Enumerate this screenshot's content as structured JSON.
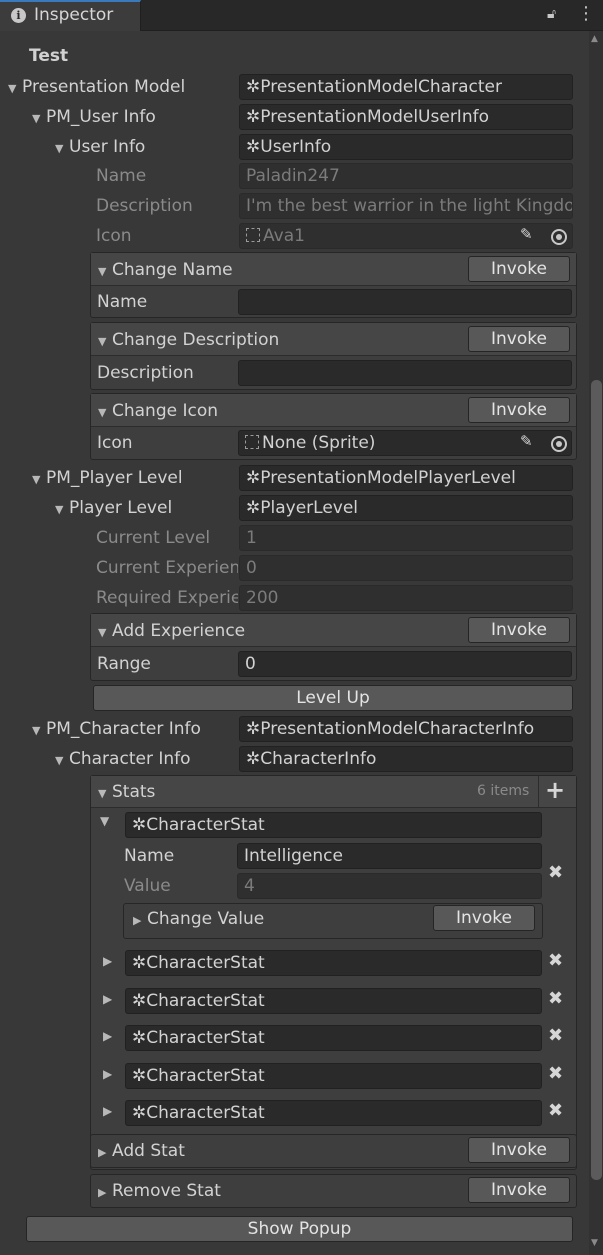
{
  "window": {
    "tab_title": "Inspector"
  },
  "header": {
    "title": "Test"
  },
  "pm": {
    "label": "Presentation Model",
    "value": "PresentationModelCharacter"
  },
  "pm_user": {
    "label": "PM_User Info",
    "value": "PresentationModelUserInfo"
  },
  "user_info": {
    "label": "User Info",
    "value": "UserInfo",
    "name_label": "Name",
    "name_value": "Paladin247",
    "desc_label": "Description",
    "desc_value": "I'm the best warrior in the light Kingdo",
    "icon_label": "Icon",
    "icon_value": "Ava1"
  },
  "change_name": {
    "label": "Change Name",
    "invoke": "Invoke",
    "param_label": "Name",
    "param_value": ""
  },
  "change_desc": {
    "label": "Change Description",
    "invoke": "Invoke",
    "param_label": "Description",
    "param_value": ""
  },
  "change_icon": {
    "label": "Change Icon",
    "invoke": "Invoke",
    "param_label": "Icon",
    "param_value": "None (Sprite)"
  },
  "pm_player": {
    "label": "PM_Player Level",
    "value": "PresentationModelPlayerLevel"
  },
  "player_level": {
    "label": "Player Level",
    "value": "PlayerLevel",
    "current_level_label": "Current Level",
    "current_level_value": "1",
    "current_exp_label": "Current Experien",
    "current_exp_value": "0",
    "required_exp_label": "Required Experie",
    "required_exp_value": "200"
  },
  "add_exp": {
    "label": "Add Experience",
    "invoke": "Invoke",
    "param_label": "Range",
    "param_value": "0"
  },
  "level_up": {
    "label": "Level Up"
  },
  "pm_char": {
    "label": "PM_Character Info",
    "value": "PresentationModelCharacterInfo"
  },
  "char_info": {
    "label": "Character Info",
    "value": "CharacterInfo"
  },
  "stats": {
    "label": "Stats",
    "count": "6 items",
    "items": [
      {
        "value": "CharacterStat",
        "name_label": "Name",
        "name_value": "Intelligence",
        "value_label": "Value",
        "value_value": "4",
        "change_label": "Change Value",
        "invoke": "Invoke"
      },
      {
        "value": "CharacterStat"
      },
      {
        "value": "CharacterStat"
      },
      {
        "value": "CharacterStat"
      },
      {
        "value": "CharacterStat"
      },
      {
        "value": "CharacterStat"
      }
    ]
  },
  "add_stat": {
    "label": "Add Stat",
    "invoke": "Invoke"
  },
  "remove_stat": {
    "label": "Remove Stat",
    "invoke": "Invoke"
  },
  "show_popup": {
    "label": "Show Popup"
  },
  "colors": {
    "background": "#383838",
    "field": "#2a2a2a",
    "button": "#585858",
    "tab_accent": "#3a79bb"
  }
}
